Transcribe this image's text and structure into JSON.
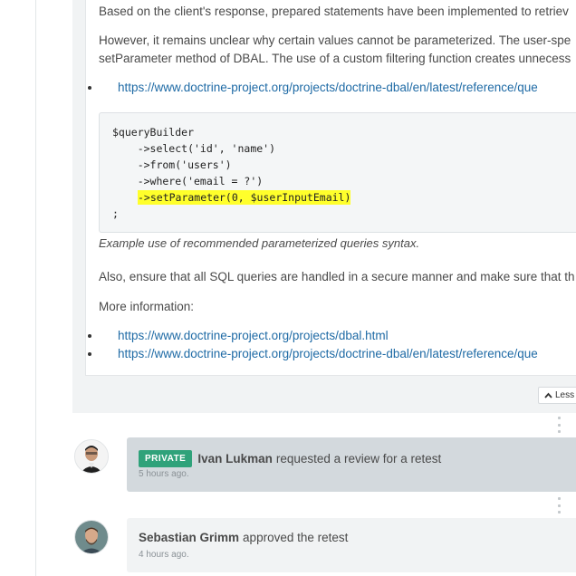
{
  "report": {
    "paragraph_1": "Based on the client's response, prepared statements have been implemented to retriev",
    "paragraph_2_line_1": "However, it remains unclear why certain values cannot be parameterized. The user-spe",
    "paragraph_2_line_2": "setParameter method of DBAL. The use of a custom filtering function creates unnecess",
    "links_1": [
      "https://www.doctrine-project.org/projects/doctrine-dbal/en/latest/reference/que"
    ],
    "code": {
      "line_1": "$queryBuilder",
      "line_2": "    ->select('id', 'name')",
      "line_3": "    ->from('users')",
      "line_4": "    ->where('email = ?')",
      "line_5": "->setParameter(0, $userInputEmail)",
      "line_6": ";"
    },
    "caption": "Example use of recommended parameterized queries syntax.",
    "paragraph_3": "Also, ensure that all SQL queries are handled in a secure manner and make sure that th",
    "more_info_label": "More information:",
    "links_2": [
      "https://www.doctrine-project.org/projects/dbal.html",
      "https://www.doctrine-project.org/projects/doctrine-dbal/en/latest/reference/que"
    ]
  },
  "less_button": {
    "label": "Less",
    "icon": "chevron-up-icon"
  },
  "activity": [
    {
      "badge": "PRIVATE",
      "actor": "Ivan Lukman",
      "action": "requested a review for a retest",
      "time": "5 hours ago."
    },
    {
      "actor": "Sebastian Grimm",
      "action": "approved the retest",
      "time": "4 hours ago."
    }
  ],
  "colors": {
    "link": "#1e6aa5",
    "badge_private": "#2fa27a",
    "code_highlight": "#ffff2b",
    "private_event_bg": "#d3d9dd"
  }
}
